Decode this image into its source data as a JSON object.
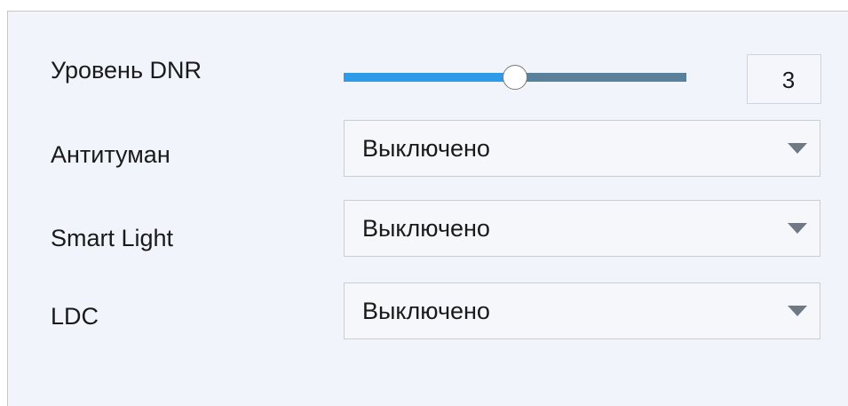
{
  "dnr": {
    "label": "Уровень DNR",
    "value": "3",
    "slider_fraction": 0.5
  },
  "antifog": {
    "label": "Антитуман",
    "selected": "Выключено"
  },
  "smart_light": {
    "label": "Smart Light",
    "selected": "Выключено"
  },
  "ldc": {
    "label": "LDC",
    "selected": "Выключено"
  },
  "colors": {
    "slider_fill": "#2e9be8",
    "slider_track": "#5a7f9a",
    "panel_bg": "#f1f4fb"
  }
}
